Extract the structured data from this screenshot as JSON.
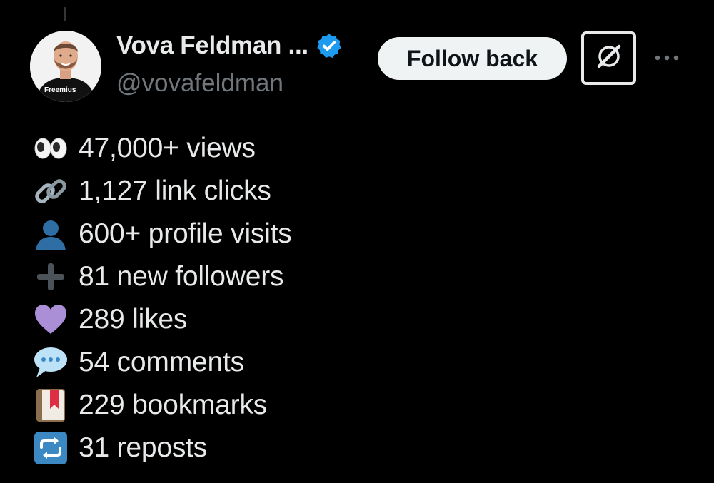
{
  "author": {
    "display_name": "Vova Feldman ...",
    "handle": "@vovafeldman",
    "avatar_badge_text": "Freemius",
    "verified": true
  },
  "actions": {
    "follow_label": "Follow back",
    "grok_icon": "grok-icon",
    "more_icon": "more-dots-icon"
  },
  "colors": {
    "background": "#000000",
    "text": "#e7e9ea",
    "secondary_text": "#71767b",
    "verified": "#1d9bf0",
    "follow_button_bg": "#eff3f4"
  },
  "stats": [
    {
      "icon": "eyes-emoji",
      "text": "47,000+ views"
    },
    {
      "icon": "link-emoji",
      "text": "1,127 link clicks"
    },
    {
      "icon": "bust-silhouette-emoji",
      "text": "600+ profile visits"
    },
    {
      "icon": "plus-emoji",
      "text": "81 new followers"
    },
    {
      "icon": "purple-heart-emoji",
      "text": "289 likes"
    },
    {
      "icon": "speech-balloon-emoji",
      "text": "54 comments"
    },
    {
      "icon": "bookmark-emoji",
      "text": "229 bookmarks"
    },
    {
      "icon": "repeat-emoji",
      "text": "31 reposts"
    }
  ]
}
